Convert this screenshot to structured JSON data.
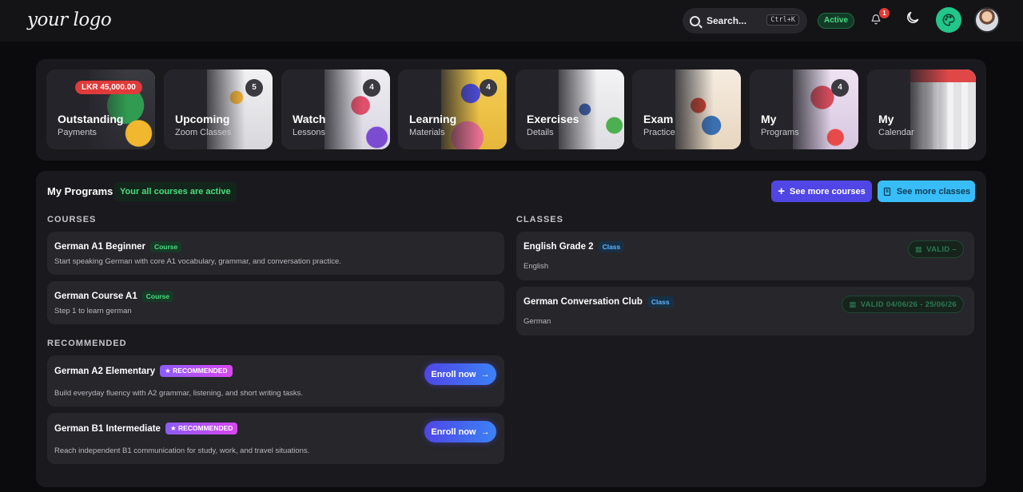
{
  "app": {
    "logo": "your logo",
    "search_label": "Search...",
    "search_shortcut": "Ctrl+K",
    "status": "Active",
    "notification_count": "1"
  },
  "tiles": [
    {
      "title": "Outstanding",
      "subtitle": "Payments",
      "price": "LKR 45,000.00",
      "art_color": "#3a8a4a"
    },
    {
      "title": "Upcoming",
      "subtitle": "Zoom Classes",
      "count": "5",
      "art_color": "#e8e8ea"
    },
    {
      "title": "Watch",
      "subtitle": "Lessons",
      "count": "4",
      "art_color": "#e6e3ee"
    },
    {
      "title": "Learning",
      "subtitle": "Materials",
      "count": "4",
      "art_color": "#f2c94c"
    },
    {
      "title": "Exercises",
      "subtitle": "Details",
      "art_color": "#ececef"
    },
    {
      "title": "Exam",
      "subtitle": "Practice",
      "art_color": "#f1e6d6"
    },
    {
      "title": "My",
      "subtitle": "Programs",
      "count": "4",
      "art_color": "#ead9f0"
    },
    {
      "title": "My",
      "subtitle": "Calendar",
      "art_color": "#e9e9ec"
    }
  ],
  "programs": {
    "title": "My Programs",
    "status": "Your all courses are active",
    "see_more_courses": "See more courses",
    "see_more_classes": "See more classes",
    "courses_heading": "COURSES",
    "classes_heading": "CLASSES",
    "recommended_heading": "RECOMMENDED",
    "courses": [
      {
        "name": "German A1 Beginner",
        "tag": "Course",
        "desc": "Start speaking German with core A1 vocabulary, grammar, and conversation practice."
      },
      {
        "name": "German Course A1",
        "tag": "Course",
        "desc": "Step 1 to learn german"
      }
    ],
    "recommended": [
      {
        "name": "German A2 Elementary",
        "tag": "RECOMMENDED",
        "desc": "Build everyday fluency with A2 grammar, listening, and short writing tasks.",
        "cta": "Enroll now"
      },
      {
        "name": "German B1 Intermediate",
        "tag": "RECOMMENDED",
        "desc": "Reach independent B1 communication for study, work, and travel situations.",
        "cta": "Enroll now"
      }
    ],
    "classes": [
      {
        "name": "English Grade 2",
        "tag": "Class",
        "desc": "English",
        "validity": "VALID –"
      },
      {
        "name": "German Conversation Club",
        "tag": "Class",
        "desc": "German",
        "validity": "VALID 04/06/26 - 25/06/26"
      }
    ]
  }
}
